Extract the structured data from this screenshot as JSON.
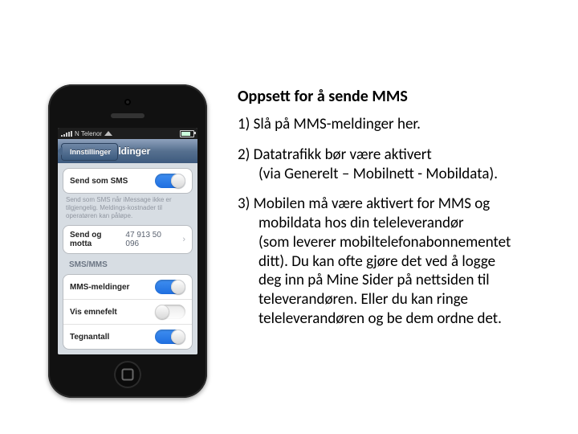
{
  "title": "Oppsett for å sende MMS",
  "steps": {
    "s1": "1) Slå på MMS-meldinger her.",
    "s2a": "2) Datatrafikk bør være aktivert",
    "s2b": "(via Generelt – Mobilnett - Mobildata).",
    "s3a": "3) Mobilen må være aktivert for MMS og",
    "s3b": "mobildata hos din teleleverandør",
    "s3c": "(som leverer mobiltelefonabonnementet",
    "s3d": "ditt). Du kan ofte gjøre det ved å logge",
    "s3e": "deg inn på Mine Sider på nettsiden til",
    "s3f": "televerandøren. Eller du kan ringe",
    "s3g": "teleleverandøren og be dem ordne det."
  },
  "phone": {
    "status": {
      "carrier": "N Telenor",
      "wifi": true
    },
    "nav": {
      "back": "Innstillinger",
      "title": "Meldinger"
    },
    "group1": {
      "row1_label": "Send som SMS",
      "row1_on": true,
      "note": "Send som SMS når iMessage ikke er tilgjengelig. Meldings-kostnader til operatøren kan påløpe."
    },
    "group2": {
      "row1_label": "Send og motta",
      "row1_value": "47 913 50 096"
    },
    "section_label": "SMS/MMS",
    "group3": {
      "r1_label": "MMS-meldinger",
      "r1_on": true,
      "r2_label": "Vis emnefelt",
      "r2_on": false,
      "r3_label": "Tegnantall",
      "r3_on": true
    }
  }
}
